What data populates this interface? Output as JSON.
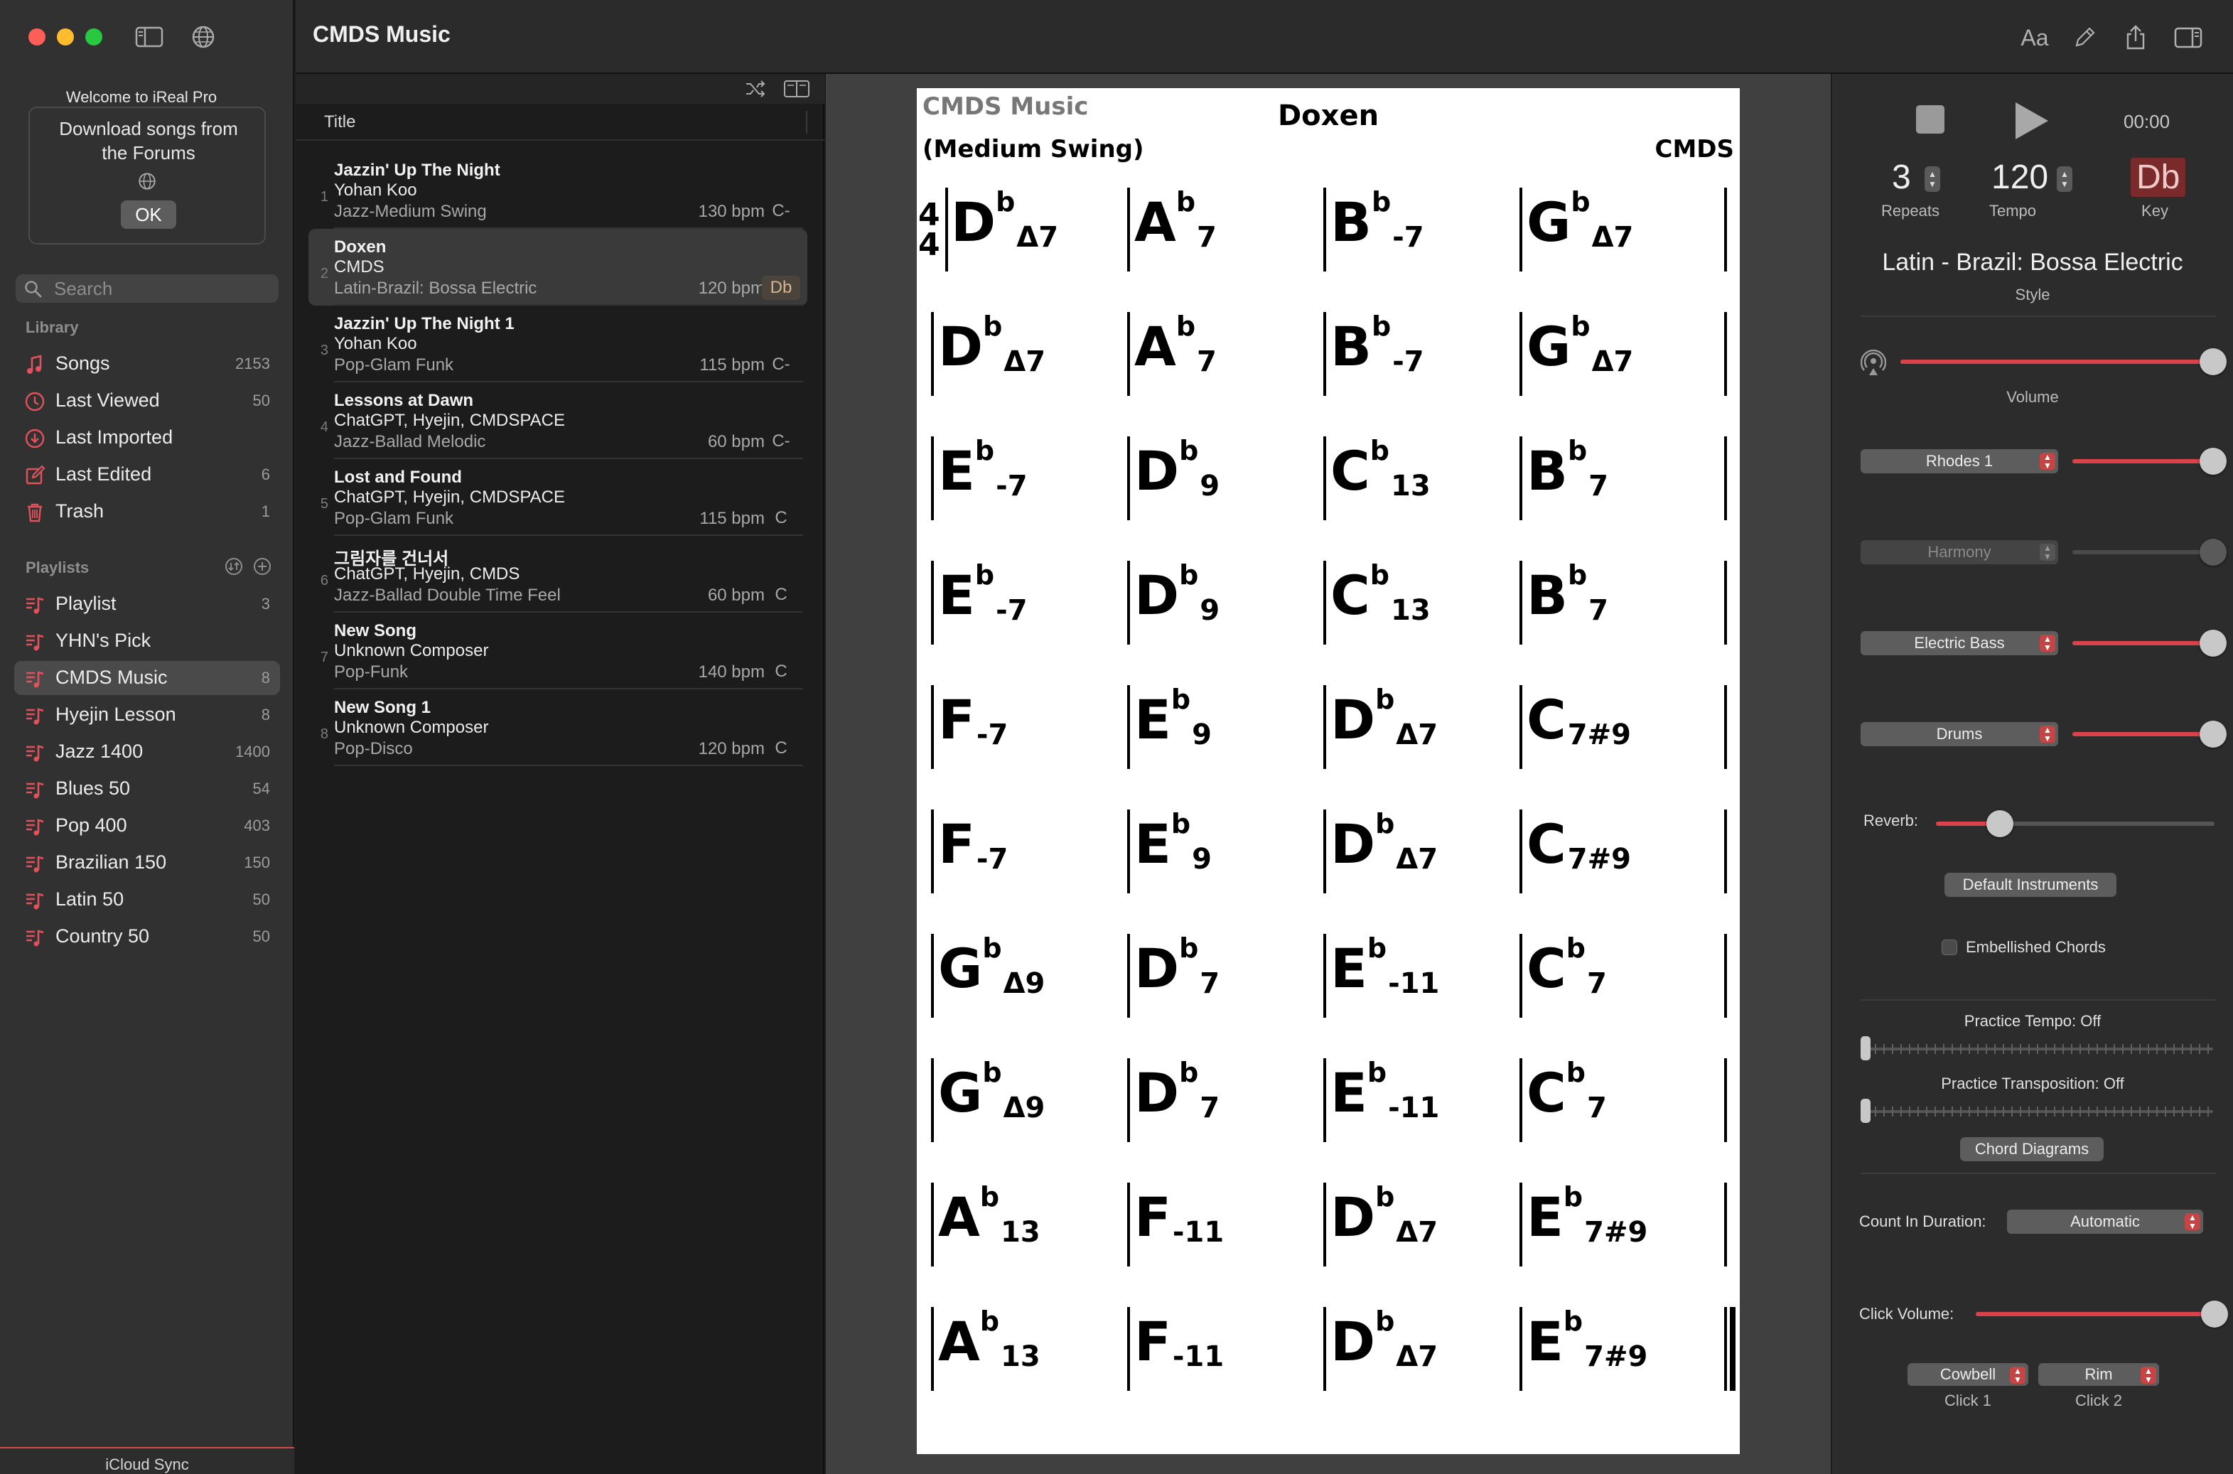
{
  "app": {
    "title": "CMDS Music"
  },
  "welcome": {
    "title": "Welcome to iReal Pro",
    "text": "Download songs from the Forums",
    "ok": "OK"
  },
  "search": {
    "placeholder": "Search"
  },
  "library": {
    "heading": "Library",
    "items": [
      {
        "label": "Songs",
        "count": "2153",
        "icon": "music-note-icon"
      },
      {
        "label": "Last Viewed",
        "count": "50",
        "icon": "clock-icon"
      },
      {
        "label": "Last Imported",
        "count": "",
        "icon": "import-icon"
      },
      {
        "label": "Last Edited",
        "count": "6",
        "icon": "edit-icon"
      },
      {
        "label": "Trash",
        "count": "1",
        "icon": "trash-icon"
      }
    ]
  },
  "playlists": {
    "heading": "Playlists",
    "items": [
      {
        "label": "Playlist",
        "count": "3"
      },
      {
        "label": "YHN's Pick",
        "count": ""
      },
      {
        "label": "CMDS Music",
        "count": "8"
      },
      {
        "label": "Hyejin Lesson",
        "count": "8"
      },
      {
        "label": "Jazz 1400",
        "count": "1400"
      },
      {
        "label": "Blues 50",
        "count": "54"
      },
      {
        "label": "Pop 400",
        "count": "403"
      },
      {
        "label": "Brazilian 150",
        "count": "150"
      },
      {
        "label": "Latin 50",
        "count": "50"
      },
      {
        "label": "Country 50",
        "count": "50"
      }
    ]
  },
  "icloud": {
    "label": "iCloud Sync"
  },
  "songlist": {
    "column_title": "Title",
    "songs": [
      {
        "n": "1",
        "title": "Jazzin' Up The Night",
        "composer": "Yohan Koo",
        "style": "Jazz-Medium Swing",
        "bpm": "130 bpm",
        "key": "C-"
      },
      {
        "n": "2",
        "title": "Doxen",
        "composer": "CMDS",
        "style": "Latin-Brazil: Bossa Electric",
        "bpm": "120 bpm",
        "key": "Db"
      },
      {
        "n": "3",
        "title": "Jazzin' Up The Night 1",
        "composer": "Yohan Koo",
        "style": "Pop-Glam Funk",
        "bpm": "115 bpm",
        "key": "C-"
      },
      {
        "n": "4",
        "title": "Lessons at Dawn",
        "composer": "ChatGPT, Hyejin, CMDSPACE",
        "style": "Jazz-Ballad Melodic",
        "bpm": "60 bpm",
        "key": "C-"
      },
      {
        "n": "5",
        "title": "Lost and Found",
        "composer": "ChatGPT, Hyejin, CMDSPACE",
        "style": "Pop-Glam Funk",
        "bpm": "115 bpm",
        "key": "C"
      },
      {
        "n": "6",
        "title": "그림자를 건너서",
        "composer": "ChatGPT, Hyejin, CMDS",
        "style": "Jazz-Ballad Double Time Feel",
        "bpm": "60 bpm",
        "key": "C"
      },
      {
        "n": "7",
        "title": "New Song",
        "composer": "Unknown Composer",
        "style": "Pop-Funk",
        "bpm": "140 bpm",
        "key": "C"
      },
      {
        "n": "8",
        "title": "New Song 1",
        "composer": "Unknown Composer",
        "style": "Pop-Disco",
        "bpm": "120 bpm",
        "key": "C"
      }
    ]
  },
  "sheet": {
    "brand": "CMDS Music",
    "title": "Doxen",
    "style": "(Medium Swing)",
    "composer": "CMDS",
    "time_signature_top": "4",
    "time_signature_bottom": "4",
    "rows": [
      [
        {
          "r": "D",
          "a": "b",
          "q": "Δ7"
        },
        {
          "r": "A",
          "a": "b",
          "q": "7"
        },
        {
          "r": "B",
          "a": "b",
          "q": "-7"
        },
        {
          "r": "G",
          "a": "b",
          "q": "Δ7"
        }
      ],
      [
        {
          "r": "D",
          "a": "b",
          "q": "Δ7"
        },
        {
          "r": "A",
          "a": "b",
          "q": "7"
        },
        {
          "r": "B",
          "a": "b",
          "q": "-7"
        },
        {
          "r": "G",
          "a": "b",
          "q": "Δ7"
        }
      ],
      [
        {
          "r": "E",
          "a": "b",
          "q": "-7"
        },
        {
          "r": "D",
          "a": "b",
          "q": "9"
        },
        {
          "r": "C",
          "a": "b",
          "q": "13"
        },
        {
          "r": "B",
          "a": "b",
          "q": "7"
        }
      ],
      [
        {
          "r": "E",
          "a": "b",
          "q": "-7"
        },
        {
          "r": "D",
          "a": "b",
          "q": "9"
        },
        {
          "r": "C",
          "a": "b",
          "q": "13"
        },
        {
          "r": "B",
          "a": "b",
          "q": "7"
        }
      ],
      [
        {
          "r": "F",
          "a": "",
          "q": "-7"
        },
        {
          "r": "E",
          "a": "b",
          "q": "9"
        },
        {
          "r": "D",
          "a": "b",
          "q": "Δ7"
        },
        {
          "r": "C",
          "a": "",
          "q": "7#9"
        }
      ],
      [
        {
          "r": "F",
          "a": "",
          "q": "-7"
        },
        {
          "r": "E",
          "a": "b",
          "q": "9"
        },
        {
          "r": "D",
          "a": "b",
          "q": "Δ7"
        },
        {
          "r": "C",
          "a": "",
          "q": "7#9"
        }
      ],
      [
        {
          "r": "G",
          "a": "b",
          "q": "Δ9"
        },
        {
          "r": "D",
          "a": "b",
          "q": "7"
        },
        {
          "r": "E",
          "a": "b",
          "q": "-11"
        },
        {
          "r": "C",
          "a": "b",
          "q": "7"
        }
      ],
      [
        {
          "r": "G",
          "a": "b",
          "q": "Δ9"
        },
        {
          "r": "D",
          "a": "b",
          "q": "7"
        },
        {
          "r": "E",
          "a": "b",
          "q": "-11"
        },
        {
          "r": "C",
          "a": "b",
          "q": "7"
        }
      ],
      [
        {
          "r": "A",
          "a": "b",
          "q": "13"
        },
        {
          "r": "F",
          "a": "",
          "q": "-11"
        },
        {
          "r": "D",
          "a": "b",
          "q": "Δ7"
        },
        {
          "r": "E",
          "a": "b",
          "q": "7#9"
        }
      ],
      [
        {
          "r": "A",
          "a": "b",
          "q": "13"
        },
        {
          "r": "F",
          "a": "",
          "q": "-11"
        },
        {
          "r": "D",
          "a": "b",
          "q": "Δ7"
        },
        {
          "r": "E",
          "a": "b",
          "q": "7#9"
        }
      ]
    ]
  },
  "player": {
    "time": "00:00",
    "repeats": "3",
    "repeats_label": "Repeats",
    "tempo": "120",
    "tempo_label": "Tempo",
    "key": "Db",
    "key_label": "Key",
    "style": "Latin - Brazil: Bossa Electric",
    "style_label": "Style",
    "volume_label": "Volume",
    "volume": 1.0,
    "instruments": [
      {
        "name": "Rhodes 1",
        "level": 1.0,
        "enabled": true
      },
      {
        "name": "Harmony",
        "level": 1.0,
        "enabled": false
      },
      {
        "name": "Electric Bass",
        "level": 1.0,
        "enabled": true
      },
      {
        "name": "Drums",
        "level": 1.0,
        "enabled": true
      }
    ],
    "reverb_label": "Reverb:",
    "reverb": 0.23,
    "default_instruments": "Default Instruments",
    "embellished": "Embellished Chords",
    "practice_tempo": "Practice Tempo: Off",
    "practice_transposition": "Practice Transposition: Off",
    "chord_diagrams": "Chord Diagrams",
    "count_in_label": "Count In Duration:",
    "count_in_value": "Automatic",
    "click_volume_label": "Click Volume:",
    "click_volume": 1.0,
    "click1": "Cowbell",
    "click1_label": "Click 1",
    "click2": "Rim",
    "click2_label": "Click 2"
  },
  "colors": {
    "accent": "#d9414b",
    "key_bg": "#7a2a2a"
  }
}
